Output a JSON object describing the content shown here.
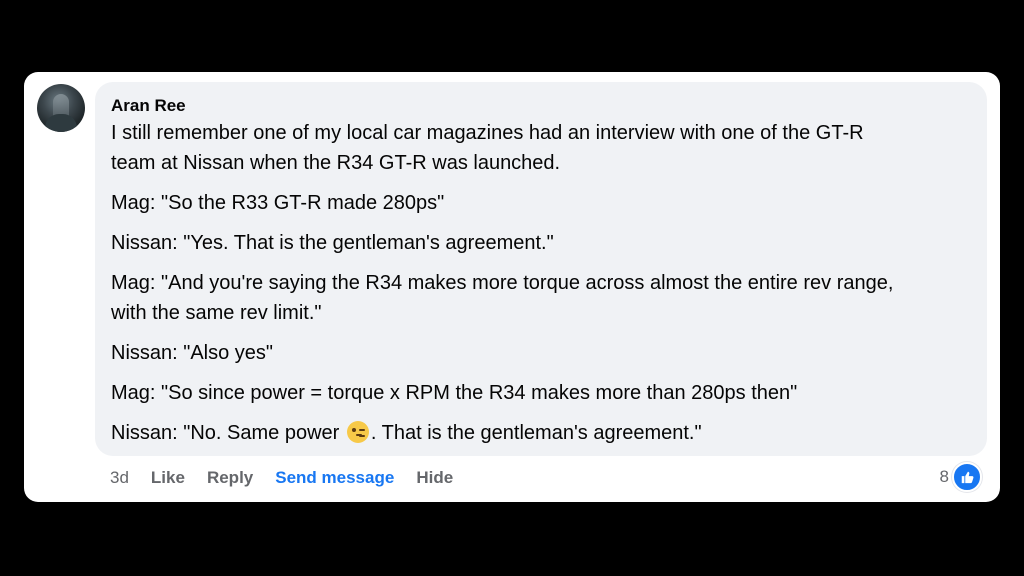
{
  "comment": {
    "author": "Aran Ree",
    "lines": [
      "I still remember one of my local car magazines had an interview with one of the GT-R",
      "team at Nissan when the R34 GT-R was launched.",
      "Mag: \"So the R33 GT-R made 280ps\"",
      "Nissan: \"Yes. That is the gentleman's agreement.\"",
      "Mag: \"And you're saying the R34 makes more torque across almost the entire rev range,",
      "with the same rev limit.\"",
      "Nissan: \"Also yes\"",
      "Mag: \"So since power = torque x RPM the R34 makes more than 280ps then\""
    ],
    "last_line_before_emoji": "Nissan: \"No. Same power ",
    "last_line_emoji": "winking-face-emoji",
    "last_line_after_emoji": ". That is the gentleman's agreement.\""
  },
  "actions": {
    "time": "3d",
    "like": "Like",
    "reply": "Reply",
    "send_message": "Send message",
    "hide": "Hide"
  },
  "reactions": {
    "count": "8",
    "icon": "thumbs-up-icon"
  },
  "colors": {
    "bubble": "#f0f2f5",
    "link_blue": "#1877f2",
    "meta_gray": "#65676b",
    "text": "#050505"
  }
}
